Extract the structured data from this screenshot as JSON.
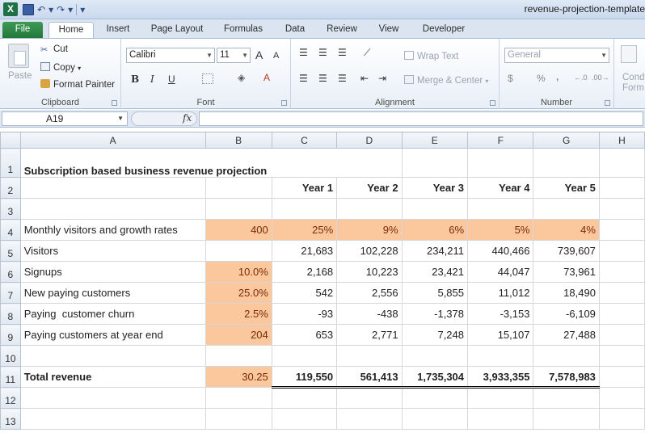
{
  "window": {
    "title": "revenue-projection-template",
    "app_icon_letter": "X"
  },
  "qat": {
    "undo": "↶",
    "redo": "↷",
    "more": "▾"
  },
  "tabs": [
    "File",
    "Home",
    "Insert",
    "Page Layout",
    "Formulas",
    "Data",
    "Review",
    "View",
    "Developer"
  ],
  "ribbon": {
    "clipboard": {
      "label": "Clipboard",
      "paste": "Paste",
      "cut": "Cut",
      "copy": "Copy",
      "format_painter": "Format Painter"
    },
    "font": {
      "label": "Font",
      "name": "Calibri",
      "size": "11",
      "bold": "B",
      "italic": "I",
      "underline": "U",
      "grow": "A",
      "shrink": "A"
    },
    "alignment": {
      "label": "Alignment",
      "wrap_text": "Wrap Text",
      "merge_center": "Merge & Center"
    },
    "number": {
      "label": "Number",
      "format": "General",
      "currency": "$",
      "percent": "%",
      "comma": ","
    },
    "styles": {
      "conditional_1": "Cond",
      "conditional_2": "Form"
    }
  },
  "formula_bar": {
    "name_box": "A19",
    "fx": "fx",
    "formula": ""
  },
  "sheet": {
    "columns": [
      "A",
      "B",
      "C",
      "D",
      "E",
      "F",
      "G",
      "H"
    ],
    "rows": [
      {
        "n": "1",
        "cells": [
          "Subscription based business revenue projection",
          "",
          "",
          "",
          "",
          "",
          ""
        ]
      },
      {
        "n": "2",
        "cells": [
          "",
          "",
          "Year 1",
          "Year 2",
          "Year 3",
          "Year 4",
          "Year 5"
        ]
      },
      {
        "n": "3",
        "cells": [
          "",
          "",
          "",
          "",
          "",
          "",
          ""
        ]
      },
      {
        "n": "4",
        "cells": [
          "Monthly visitors and growth rates",
          "400",
          "25%",
          "9%",
          "6%",
          "5%",
          "4%"
        ]
      },
      {
        "n": "5",
        "cells": [
          "Visitors",
          "",
          "21,683",
          "102,228",
          "234,211",
          "440,466",
          "739,607"
        ]
      },
      {
        "n": "6",
        "cells": [
          "Signups",
          "10.0%",
          "2,168",
          "10,223",
          "23,421",
          "44,047",
          "73,961"
        ]
      },
      {
        "n": "7",
        "cells": [
          "New paying customers",
          "25.0%",
          "542",
          "2,556",
          "5,855",
          "11,012",
          "18,490"
        ]
      },
      {
        "n": "8",
        "cells": [
          "Paying  customer churn",
          "2.5%",
          "-93",
          "-438",
          "-1,378",
          "-3,153",
          "-6,109"
        ]
      },
      {
        "n": "9",
        "cells": [
          "Paying customers at year end",
          "204",
          "653",
          "2,771",
          "7,248",
          "15,107",
          "27,488"
        ]
      },
      {
        "n": "10",
        "cells": [
          "",
          "",
          "",
          "",
          "",
          "",
          ""
        ]
      },
      {
        "n": "11",
        "cells": [
          "Total revenue",
          "30.25",
          "119,550",
          "561,413",
          "1,735,304",
          "3,933,355",
          "7,578,983"
        ]
      },
      {
        "n": "12",
        "cells": [
          "",
          "",
          "",
          "",
          "",
          "",
          ""
        ]
      },
      {
        "n": "13",
        "cells": [
          "",
          "",
          "",
          "",
          "",
          "",
          ""
        ]
      }
    ]
  },
  "colors": {
    "input_fill": "#fbc79c",
    "file_tab": "#21793a",
    "selected_row_header": "#f1c15f"
  }
}
